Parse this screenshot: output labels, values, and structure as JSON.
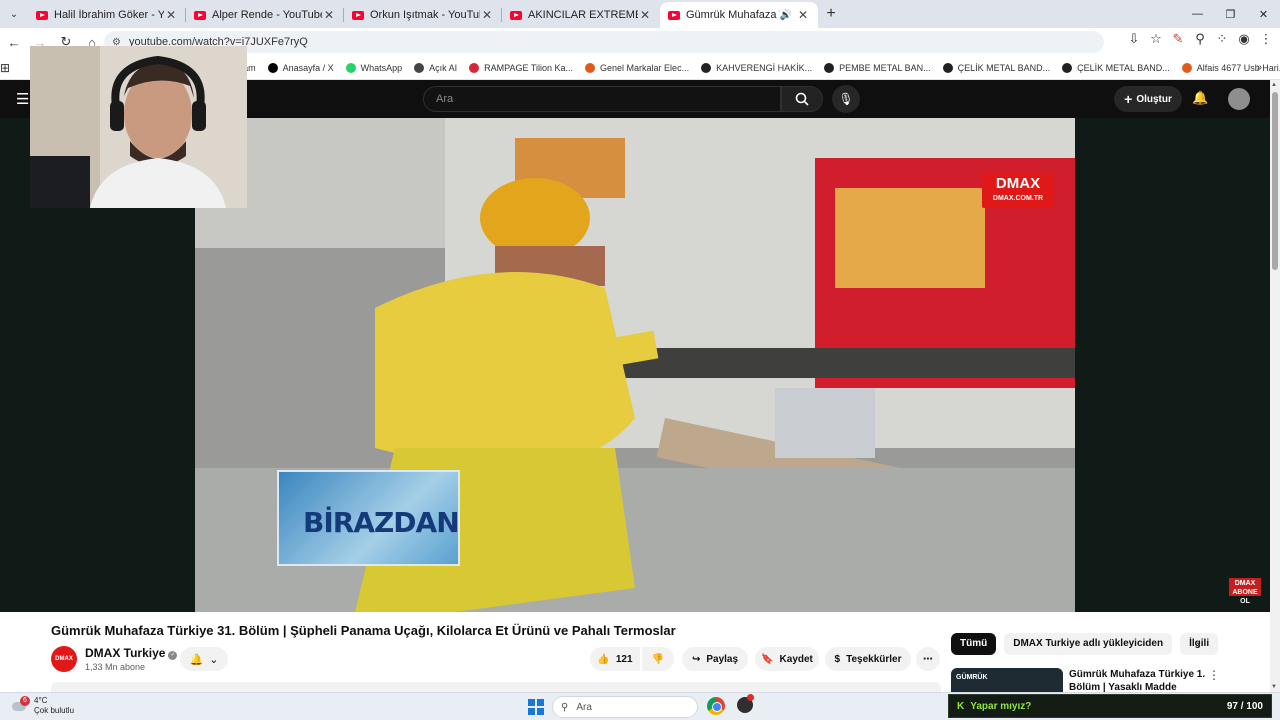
{
  "browser": {
    "tabs": [
      {
        "title": "Halil İbrahim Göker - YouTube",
        "active": false
      },
      {
        "title": "Alper Rende - YouTube",
        "active": false
      },
      {
        "title": "Orkun Işıtmak - YouTube",
        "active": false
      },
      {
        "title": "AKINCILAR EXTREME OFFROAD",
        "active": false
      },
      {
        "title": "Gümrük Muhafaza Türkiye",
        "active": true
      }
    ],
    "url": "youtube.com/watch?v=i7JUXFe7ryQ",
    "bookmarks": [
      {
        "label": "am",
        "color": "#aaaaaa"
      },
      {
        "label": "Anasayfa / X",
        "color": "#000000"
      },
      {
        "label": "WhatsApp",
        "color": "#25d366"
      },
      {
        "label": "Açık AI",
        "color": "#444444"
      },
      {
        "label": "RAMPAGE Tilion Ka...",
        "color": "#d6263a"
      },
      {
        "label": "Genel Markalar Elec...",
        "color": "#e05a1c"
      },
      {
        "label": "KAHVERENGİ HAKİK...",
        "color": "#222222"
      },
      {
        "label": "PEMBE METAL BAN...",
        "color": "#222222"
      },
      {
        "label": "ÇELİK METAL BAND...",
        "color": "#222222"
      },
      {
        "label": "ÇELİK METAL BAND...",
        "color": "#222222"
      },
      {
        "label": "Alfais 4677 Usb Hari...",
        "color": "#e05a1c"
      }
    ]
  },
  "youtube": {
    "search_placeholder": "Ara",
    "create_label": "Oluştur",
    "video": {
      "overlay_logo": "DMAX",
      "overlay_logo_sub": "DMAX.COM.TR",
      "corner_logo": "DMAX",
      "corner_logo_sub": "ABONE OL",
      "lower_third": "BİRAZDAN",
      "title": "Gümrük Muhafaza Türkiye 31. Bölüm | Şüpheli Panama Uçağı, Kilolarca Et Ürünü ve Pahalı Termoslar"
    },
    "channel": {
      "logo_text": "DMAX",
      "name": "DMAX Turkiye",
      "subscribers": "1,33 Mn abone"
    },
    "actions": {
      "likes": "121",
      "share": "Paylaş",
      "save": "Kaydet",
      "thanks": "Teşekkürler"
    },
    "chips": [
      {
        "label": "Tümü",
        "active": true
      },
      {
        "label": "DMAX Turkiye adlı yükleyiciden",
        "active": false
      },
      {
        "label": "İlgili",
        "active": false
      }
    ],
    "recommendation": {
      "thumb_text": "GÜMRÜK",
      "title": "Gümrük Muhafaza Türkiye 1. Bölüm | Yasaklı Madde"
    }
  },
  "taskbar": {
    "weather_badge": "6",
    "temperature": "4°C",
    "weather_desc": "Çok bulutlu",
    "search_placeholder": "Ara",
    "widget_title": "Yapar mıyız?",
    "widget_score": "97 / 100"
  }
}
